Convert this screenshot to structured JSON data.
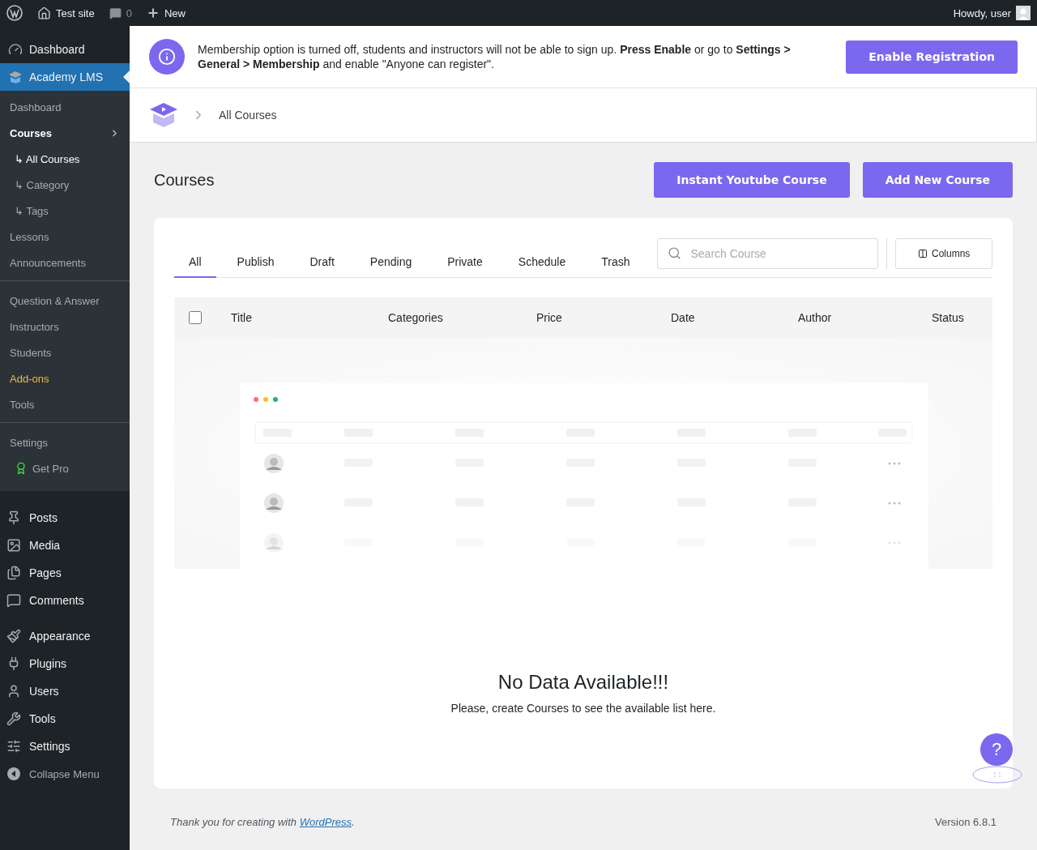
{
  "admin_bar": {
    "site": "Test site",
    "comments": "0",
    "new": "New",
    "greeting": "Howdy, user"
  },
  "sidebar": {
    "top": [
      {
        "label": "Dashboard",
        "selected": false
      },
      {
        "label": "Academy LMS",
        "selected": true
      }
    ],
    "submenu_groups": [
      [
        {
          "label": "Dashboard",
          "kind": "link"
        },
        {
          "label": "Courses",
          "kind": "parent",
          "expanded": true,
          "children": [
            {
              "label": "↳ All Courses",
              "selected": true
            },
            {
              "label": "↳ Category",
              "selected": false
            },
            {
              "label": "↳ Tags",
              "selected": false
            }
          ]
        },
        {
          "label": "Lessons",
          "kind": "link"
        },
        {
          "label": "Announcements",
          "kind": "link"
        }
      ],
      [
        {
          "label": "Question & Answer",
          "kind": "link"
        },
        {
          "label": "Instructors",
          "kind": "link"
        },
        {
          "label": "Students",
          "kind": "link"
        },
        {
          "label": "Add-ons",
          "kind": "accent"
        },
        {
          "label": "Tools",
          "kind": "link"
        }
      ],
      [
        {
          "label": "Settings",
          "kind": "link"
        },
        {
          "label": "Get Pro",
          "kind": "pro"
        }
      ]
    ],
    "menu_groups": [
      [
        "Posts",
        "Media",
        "Pages",
        "Comments"
      ],
      [
        "Appearance",
        "Plugins",
        "Users",
        "Tools",
        "Settings"
      ]
    ],
    "collapse": "Collapse Menu"
  },
  "notice": {
    "text": "Membership option is turned off, students and instructors will not be able to sign up. **Press Enable** or go to **Settings > General > Membership** and enable \"Anyone can register\".",
    "button": "Enable Registration"
  },
  "breadcrumb": "All Courses",
  "page": {
    "title": "Courses",
    "buttons": [
      "Instant Youtube Course",
      "Add New Course"
    ]
  },
  "tabs": [
    {
      "label": "All",
      "selected": true
    },
    {
      "label": "Publish",
      "selected": false
    },
    {
      "label": "Draft",
      "selected": false
    },
    {
      "label": "Pending",
      "selected": false
    },
    {
      "label": "Private",
      "selected": false
    },
    {
      "label": "Schedule",
      "selected": false
    },
    {
      "label": "Trash",
      "selected": false
    }
  ],
  "search": {
    "placeholder": "Search Course"
  },
  "columns_button": "Columns",
  "table": {
    "select_all": {
      "checked": false
    },
    "columns": [
      "Title",
      "Categories",
      "Price",
      "Date",
      "Author",
      "Status"
    ]
  },
  "empty": {
    "title": "No Data Available!!!",
    "message": "Please, create Courses to see the available list here."
  },
  "help": "?",
  "footer": {
    "before": "Thank you for creating with ",
    "link": "WordPress",
    "after": ".",
    "version": "Version 6.8.1"
  }
}
